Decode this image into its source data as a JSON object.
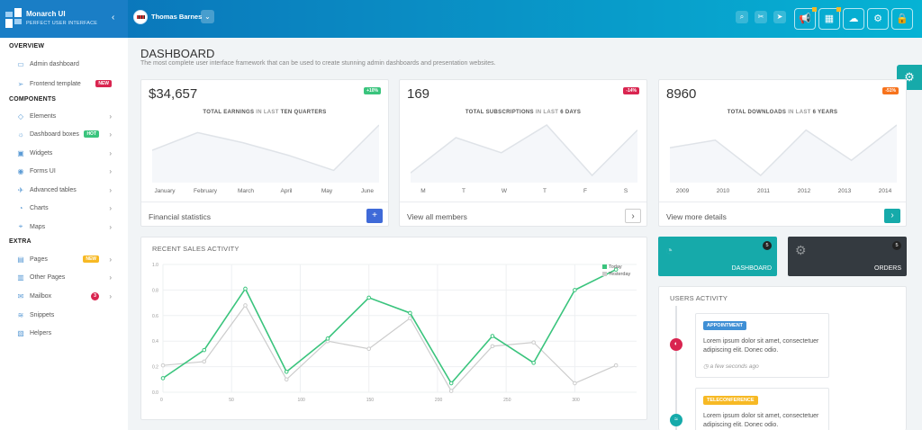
{
  "app": {
    "name": "Monarch UI",
    "tagline": "PERFECT USER INTERFACE",
    "collapse_icon": "chevron-left-icon"
  },
  "header": {
    "user_name": "Thomas Barnes",
    "dropdown_icon": "chevron-down-icon",
    "quick_icons": [
      "search-icon",
      "scissors-icon",
      "paper-plane-icon"
    ],
    "buttons": [
      "megaphone-icon",
      "grid-icon",
      "cloud-icon",
      "gear-icon",
      "lock-icon"
    ]
  },
  "sidebar": {
    "sections": [
      {
        "title": "OVERVIEW"
      },
      {
        "title": "COMPONENTS"
      },
      {
        "title": "EXTRA"
      }
    ],
    "items": [
      {
        "label": "Admin dashboard",
        "icon": "monitor-icon"
      },
      {
        "label": "Frontend template",
        "icon": "paper-plane-icon",
        "badge": "NEW"
      },
      {
        "label": "Elements",
        "icon": "diamond-icon"
      },
      {
        "label": "Dashboard boxes",
        "icon": "lightbulb-icon",
        "badge": "HOT"
      },
      {
        "label": "Widgets",
        "icon": "window-icon"
      },
      {
        "label": "Forms UI",
        "icon": "eye-icon"
      },
      {
        "label": "Advanced tables",
        "icon": "rocket-icon"
      },
      {
        "label": "Charts",
        "icon": "chart-icon"
      },
      {
        "label": "Maps",
        "icon": "map-icon"
      },
      {
        "label": "Pages",
        "icon": "pages-icon",
        "badge": "NEW"
      },
      {
        "label": "Other Pages",
        "icon": "folder-icon"
      },
      {
        "label": "Mailbox",
        "icon": "mail-icon",
        "badge": "3"
      },
      {
        "label": "Snippets",
        "icon": "stack-icon"
      },
      {
        "label": "Helpers",
        "icon": "helpers-icon"
      }
    ]
  },
  "page": {
    "title": "DASHBOARD",
    "subtitle": "The most complete user interface framework that can be used to create stunning admin dashboards and presentation websites."
  },
  "stats": [
    {
      "value": "$34,657",
      "change": "+10%",
      "label_a": "TOTAL EARNINGS",
      "label_b": "IN LAST",
      "label_c": "TEN QUARTERS",
      "x_labels": [
        "January",
        "February",
        "March",
        "April",
        "May",
        "June"
      ],
      "values": [
        0.5,
        0.85,
        0.65,
        0.4,
        0.1,
        1.0
      ],
      "footer": "Financial statistics",
      "button": "plus-icon"
    },
    {
      "value": "169",
      "change": "-14%",
      "label_a": "TOTAL SUBSCRIPTIONS",
      "label_b": "IN LAST",
      "label_c": "6 DAYS",
      "x_labels": [
        "M",
        "T",
        "W",
        "T",
        "F",
        "S"
      ],
      "values": [
        0.05,
        0.75,
        0.45,
        1.0,
        0.0,
        0.9
      ],
      "footer": "View all members",
      "button": "chevron-right-icon"
    },
    {
      "value": "8960",
      "change": "-51%",
      "label_a": "TOTAL DOWNLOADS",
      "label_b": "IN LAST",
      "label_c": "6 YEARS",
      "x_labels": [
        "2009",
        "2010",
        "2011",
        "2012",
        "2013",
        "2014"
      ],
      "values": [
        0.55,
        0.7,
        0.0,
        0.9,
        0.3,
        1.0
      ],
      "footer": "View more details",
      "button": "chevron-right-icon"
    }
  ],
  "chart_data": {
    "type": "line",
    "title": "RECENT SALES ACTIVITY",
    "x": [
      0,
      30,
      60,
      90,
      120,
      150,
      180,
      210,
      240,
      270,
      300,
      330
    ],
    "x_ticks": [
      "0",
      "50",
      "100",
      "150",
      "200",
      "250",
      "300"
    ],
    "y_ticks": [
      "0.0",
      "0.2",
      "0.4",
      "0.6",
      "0.8",
      "1.0"
    ],
    "ylim": [
      0,
      1
    ],
    "xlim": [
      0,
      345
    ],
    "legend_position": "top-right",
    "series": [
      {
        "name": "Today",
        "color": "#3ac47d",
        "values": [
          0.11,
          0.33,
          0.81,
          0.16,
          0.42,
          0.74,
          0.62,
          0.07,
          0.44,
          0.23,
          0.8,
          0.96
        ]
      },
      {
        "name": "Yesterday",
        "color": "#cccccc",
        "values": [
          0.21,
          0.24,
          0.68,
          0.1,
          0.4,
          0.34,
          0.58,
          0.01,
          0.36,
          0.39,
          0.07,
          0.21
        ]
      }
    ]
  },
  "tiles": [
    {
      "label": "DASHBOARD",
      "count": "5",
      "icon": "dashboard-icon",
      "color": "#16aaaa"
    },
    {
      "label": "ORDERS",
      "count": "5",
      "icon": "gears-icon",
      "color": "#343a40"
    }
  ],
  "users_activity": {
    "title": "USERS ACTIVITY",
    "events": [
      {
        "tag": "APPOINTMENT",
        "tag_color": "#3f8fd5",
        "text": "Lorem ipsum dolor sit amet, consectetuer adipiscing elit. Donec odio.",
        "time": "a few seconds ago",
        "icon": "toggle-icon",
        "icon_color": "#d92550"
      },
      {
        "tag": "TELECONFERENCE",
        "tag_color": "#f7b924",
        "text": "Lorem ipsum dolor sit amet, consectetuer adipiscing elit. Donec odio.",
        "time": "",
        "icon": "wifi-icon",
        "icon_color": "#16aaaa"
      }
    ]
  }
}
